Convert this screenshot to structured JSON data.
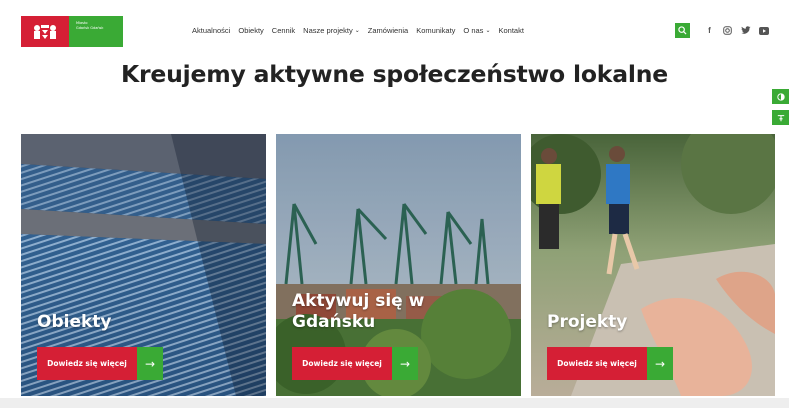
{
  "header": {
    "logo_text": [
      "Miasto",
      "Gdańsk Gdańsk"
    ],
    "nav": [
      {
        "label": "Aktualności",
        "has_dropdown": false
      },
      {
        "label": "Obiekty",
        "has_dropdown": false
      },
      {
        "label": "Cennik",
        "has_dropdown": false
      },
      {
        "label": "Nasze projekty",
        "has_dropdown": true
      },
      {
        "label": "Zamówienia",
        "has_dropdown": false
      },
      {
        "label": "Komunikaty",
        "has_dropdown": false
      },
      {
        "label": "O nas",
        "has_dropdown": true
      },
      {
        "label": "Kontakt",
        "has_dropdown": false
      }
    ],
    "social": [
      {
        "name": "facebook-icon",
        "glyph": "f"
      },
      {
        "name": "instagram-icon",
        "glyph": "◎"
      },
      {
        "name": "twitter-icon",
        "glyph": "🐦"
      },
      {
        "name": "youtube-icon",
        "glyph": "▶"
      }
    ]
  },
  "hero": {
    "title": "Kreujemy aktywne społeczeństwo lokalne"
  },
  "cards": [
    {
      "title": "Obiekty",
      "cta": "Dowiedz się więcej"
    },
    {
      "title": "Aktywuj się w Gdańsku",
      "cta": "Dowiedz się więcej"
    },
    {
      "title": "Projekty",
      "cta": "Dowiedz się więcej"
    }
  ],
  "colors": {
    "brand_red": "#d51f35",
    "brand_green": "#3aaa35"
  }
}
